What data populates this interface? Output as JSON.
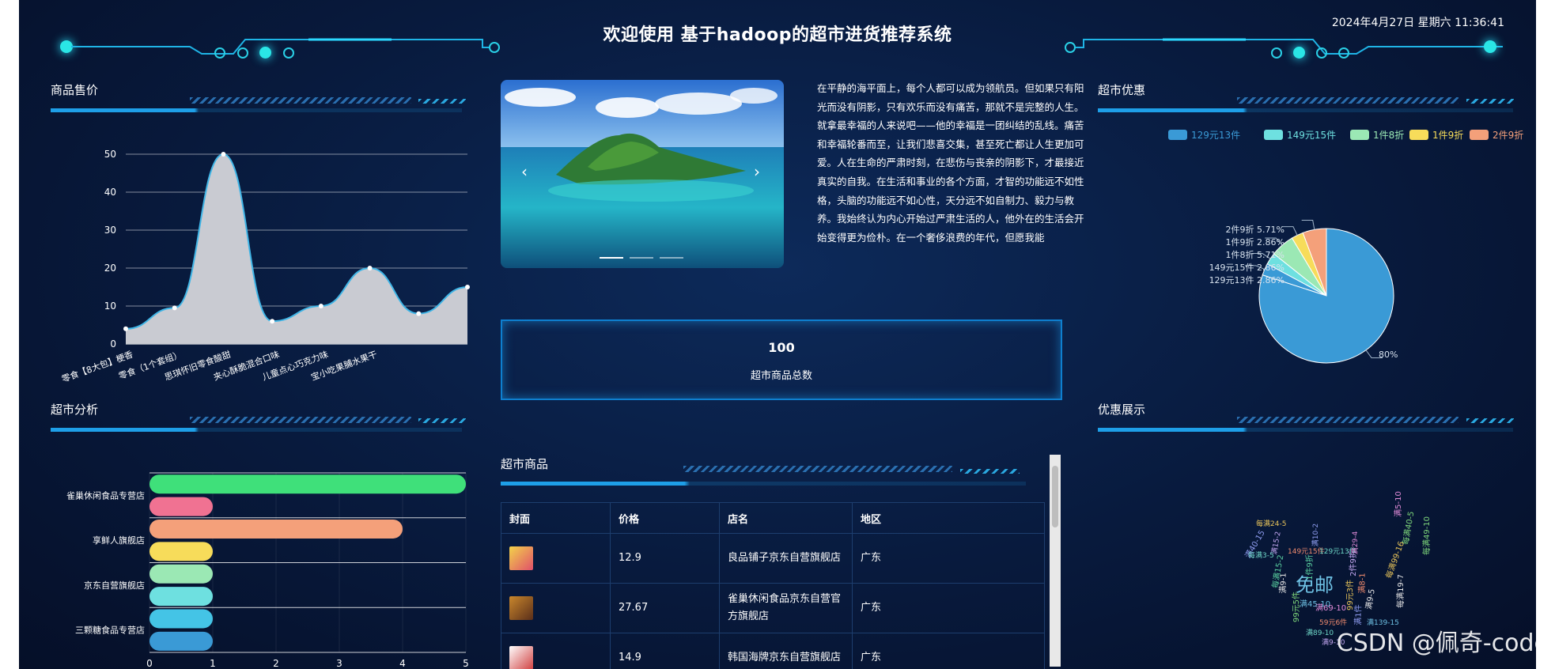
{
  "header": {
    "title": "欢迎使用 基于hadoop的超市进货推荐系统",
    "datetime": "2024年4月27日 星期六 11:36:41"
  },
  "panels": {
    "price": "商品售价",
    "analysis": "超市分析",
    "discount": "超市优惠",
    "discount_show": "优惠展示",
    "goods": "超市商品"
  },
  "carousel": {
    "prev": "‹",
    "next": "›"
  },
  "intro_text": "在平静的海平面上，每个人都可以成为领航员。但如果只有阳光而没有阴影，只有欢乐而没有痛苦，那就不是完整的人生。就拿最幸福的人来说吧——他的幸福是一团纠结的乱线。痛苦和幸福轮番而至，让我们悲喜交集，甚至死亡都让人生更加可爱。人在生命的严肃时刻，在悲伤与丧亲的阴影下，才最接近真实的自我。在生活和事业的各个方面，才智的功能远不如性格，头脑的功能远不如心性，天分远不如自制力、毅力与教养。我始终认为内心开始过严肃生活的人，他外在的生活会开始变得更为俭朴。在一个奢侈浪费的年代，但愿我能",
  "total": {
    "value": "100",
    "label": "超市商品总数"
  },
  "table": {
    "headers": [
      "封面",
      "价格",
      "店名",
      "地区"
    ],
    "rows": [
      {
        "price": "12.9",
        "shop": "良品铺子京东自营旗舰店",
        "region": "广东"
      },
      {
        "price": "27.67",
        "shop": "雀巢休闲食品京东自营官方旗舰店",
        "region": "广东"
      },
      {
        "price": "14.9",
        "shop": "韩国海牌京东自营旗舰店",
        "region": "广东"
      }
    ]
  },
  "watermark": "CSDN @佩奇-code",
  "chart_data": [
    {
      "type": "area",
      "title": "商品售价",
      "x": [
        "[8大包] 梗香",
        "零食 (1个套组)",
        "思琪怀旧零食酸甜",
        "夹心酥脆混合口味",
        "儿童点心巧克力味",
        "宝小吃果脯水果干",
        "",
        "",
        ""
      ],
      "tick_labels": [
        "零食【8大包】梗香",
        "零食（1个套组）",
        "思琪怀旧零食酸甜",
        "夹心酥脆混合口味",
        "儿童点心巧克力味",
        "宝小吃果脯水果干"
      ],
      "values": [
        4,
        9.5,
        50,
        6,
        10,
        20,
        8,
        15
      ],
      "yticks": [
        0,
        10,
        20,
        30,
        40,
        50
      ],
      "ylim": [
        0,
        50
      ],
      "color": "#c9cbd2",
      "line_color": "#3fb5e6"
    },
    {
      "type": "bar",
      "title": "超市分析",
      "orientation": "horizontal",
      "categories": [
        "三颗糖食品专营店",
        "",
        "京东自营旗舰店",
        "",
        "享鲜人旗舰店",
        "",
        "雀巢休闲食品专营店",
        ""
      ],
      "ytick_labels": [
        "三颗糖食品专营店",
        "京东自营旗舰店",
        "享鲜人旗舰店",
        "雀巢休闲食品专营店"
      ],
      "values": [
        1,
        1,
        1,
        1,
        1,
        4,
        1,
        5
      ],
      "colors": [
        "#3a9ad6",
        "#44c4e6",
        "#6ee0e0",
        "#9be8b4",
        "#f7dc5a",
        "#f4a07a",
        "#f07292",
        "#3fe07a"
      ],
      "xticks": [
        0,
        1,
        2,
        3,
        4,
        5
      ],
      "xlim": [
        0,
        5
      ]
    },
    {
      "type": "pie",
      "title": "超市优惠",
      "legend_position": "top",
      "series": [
        {
          "name": "129元13件",
          "value": 2.86,
          "color": "#3a9ad6",
          "label": "129元13件 2.86%"
        },
        {
          "name": "149元15件",
          "value": 2.86,
          "color": "#6ee0e0",
          "label": "149元15件 2.86%"
        },
        {
          "name": "1件8折",
          "value": 5.71,
          "color": "#9be8b4",
          "label": "1件8折 5.71%"
        },
        {
          "name": "1件9折",
          "value": 2.86,
          "color": "#f7dc5a",
          "label": "1件9折 2.86%"
        },
        {
          "name": "2件9折",
          "value": 5.71,
          "color": "#f4a07a",
          "label": "2件9折 5.71%"
        },
        {
          "name": "",
          "value": 80,
          "color": "#3a9ad6",
          "label": "80%"
        }
      ]
    }
  ],
  "wordcloud": {
    "words": [
      "免邮",
      "满5-10",
      "每满40-5",
      "每满24-5",
      "满10-2",
      "149元15件",
      "129元13件",
      "2件9折",
      "满9-1",
      "每满15-2",
      "满45-10",
      "满69-10",
      "99元5件",
      "每满99-16",
      "满40-15",
      "满8-1",
      "每满3-5",
      "满15-2",
      "满9-5",
      "1件9折",
      "满139-15",
      "满29-4",
      "每满49-10",
      "99元3件",
      "满1件",
      "59元6件",
      "满89-10",
      "满9-10",
      "每满19-7"
    ]
  }
}
